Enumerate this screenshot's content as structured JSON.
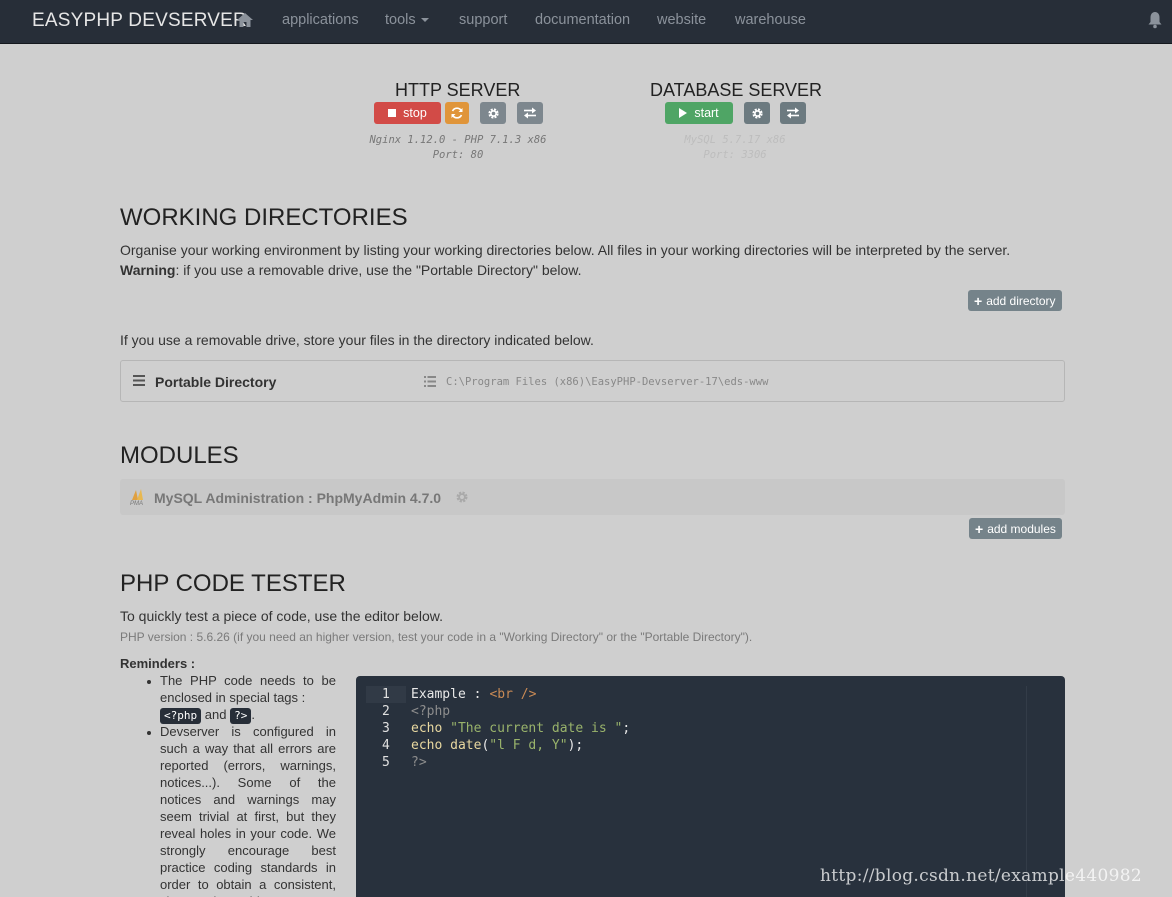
{
  "nav": {
    "brand": "EASYPHP DEVSERVER",
    "items": [
      "applications",
      "tools",
      "support",
      "documentation",
      "website",
      "warehouse"
    ]
  },
  "http": {
    "title": "HTTP SERVER",
    "stop_label": "stop",
    "info_line1": "Nginx 1.12.0 - PHP 7.1.3 x86",
    "info_line2": "Port: 80"
  },
  "db": {
    "title": "DATABASE SERVER",
    "start_label": "start",
    "info_line1": "MySQL 5.7.17 x86",
    "info_line2": "Port: 3306"
  },
  "working": {
    "title": "WORKING DIRECTORIES",
    "desc": "Organise your working environment by listing your working directories below. All files in your working directories will be interpreted by the server.",
    "warning_label": "Warning",
    "warning_text": ": if you use a removable drive, use the \"Portable Directory\" below.",
    "add_label": "add directory",
    "removable_text": "If you use a removable drive, store your files in the directory indicated below.",
    "portable_label": "Portable Directory",
    "portable_path": "C:\\Program Files (x86)\\EasyPHP-Devserver-17\\eds-www"
  },
  "modules": {
    "title": "MODULES",
    "module_name": "MySQL Administration : PhpMyAdmin 4.7.0",
    "pma_text": "PMA",
    "add_label": "add modules"
  },
  "tester": {
    "title": "PHP CODE TESTER",
    "intro": "To quickly test a piece of code, use the editor below.",
    "version_note": "PHP version : 5.6.26 (if you need an higher version, test your code in a \"Working Directory\" or the \"Portable Directory\").",
    "reminders_title": "Reminders :",
    "reminder1_text": "The PHP code needs to be enclosed in special tags :",
    "tag_open": "<?php",
    "tag_and": "and",
    "tag_close": "?>",
    "reminder2_text": "Devserver is configured in such a way that all errors are reported (errors, warnings, notices...). Some of the notices and warnings may seem trivial at first, but they reveal holes in your code. We strongly encourage best practice coding standards in order to obtain a consistent, clean and portable"
  },
  "editor": {
    "line_numbers": [
      "1",
      "2",
      "3",
      "4",
      "5"
    ],
    "l1_text": "Example :",
    "l1_tag": "<br />",
    "l2": "<?php",
    "l3_kw": "echo",
    "l3_str": "\"The current date is \"",
    "l3_end": ";",
    "l4_kw": "echo date",
    "l4_open": "(",
    "l4_str": "\"l F d, Y\"",
    "l4_end": ");",
    "l5": "?>"
  },
  "watermark": "http://blog.csdn.net/example440982",
  "colors": {
    "navbar": "#272e38",
    "stop": "#d24b47",
    "restart": "#e0953a",
    "start": "#4fa565",
    "editor_bg": "#28313d"
  }
}
